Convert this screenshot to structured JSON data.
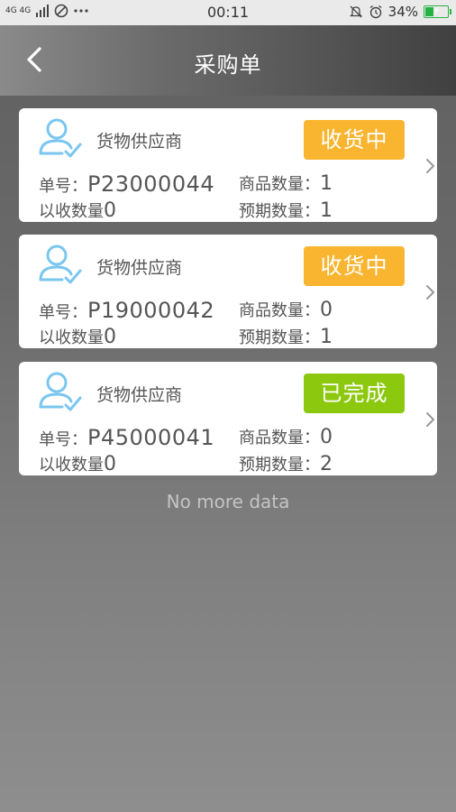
{
  "status_bar": {
    "network": "4G 4G",
    "time": "00:11",
    "battery": "34%",
    "battery_level": 0.34
  },
  "header": {
    "title": "采购单"
  },
  "orders": [
    {
      "supplier": "货物供应商",
      "status": "收货中",
      "status_color": "#f9b530",
      "order_no_label": "单号：",
      "order_no": "P23000044",
      "goods_qty_label": "商品数量：",
      "goods_qty": "1",
      "received_label": "以收数量",
      "received": "0",
      "expected_label": "预期数量：",
      "expected": "1"
    },
    {
      "supplier": "货物供应商",
      "status": "收货中",
      "status_color": "#f9b530",
      "order_no_label": "单号：",
      "order_no": "P19000042",
      "goods_qty_label": "商品数量：",
      "goods_qty": "0",
      "received_label": "以收数量",
      "received": "0",
      "expected_label": "预期数量：",
      "expected": "1"
    },
    {
      "supplier": "货物供应商",
      "status": "已完成",
      "status_color": "#8cc80e",
      "order_no_label": "单号：",
      "order_no": "P45000041",
      "goods_qty_label": "商品数量：",
      "goods_qty": "0",
      "received_label": "以收数量",
      "received": "0",
      "expected_label": "预期数量：",
      "expected": "2"
    }
  ],
  "footer": {
    "no_more": "No more data"
  }
}
